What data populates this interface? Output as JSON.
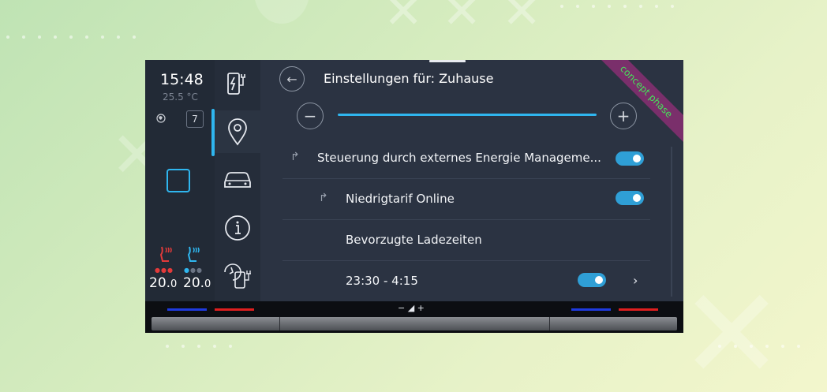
{
  "status": {
    "time": "15:48",
    "outside_temp": "25.5 °C",
    "badge": "7",
    "seat_left_temp": "20.0",
    "seat_right_temp": "20.0"
  },
  "header": {
    "title": "Einstellungen für: Zuhause",
    "ribbon": "concept phase"
  },
  "rows": [
    {
      "label": "Steuerung durch externes Energie Manageme...",
      "toggle_on": true
    },
    {
      "label": "Niedrigtarif Online",
      "toggle_on": true
    },
    {
      "label": "Bevorzugte Ladezeiten"
    },
    {
      "label": "23:30 - 4:15",
      "toggle_on": true
    }
  ],
  "bottom": {
    "vol_label": "− ◢ +"
  },
  "icons": {
    "back": "back-arrow-icon",
    "charging": "charging-station-icon",
    "location": "location-pin-icon",
    "car": "car-icon",
    "info": "info-icon",
    "timer_charging": "timer-charging-icon"
  },
  "colors": {
    "accent": "#2fb6ef",
    "ribbon": "#7a2f6b",
    "ribbon_text": "#46e05a",
    "seat_heat": "#e23a3a",
    "seat_cool": "#2fb6ef"
  }
}
